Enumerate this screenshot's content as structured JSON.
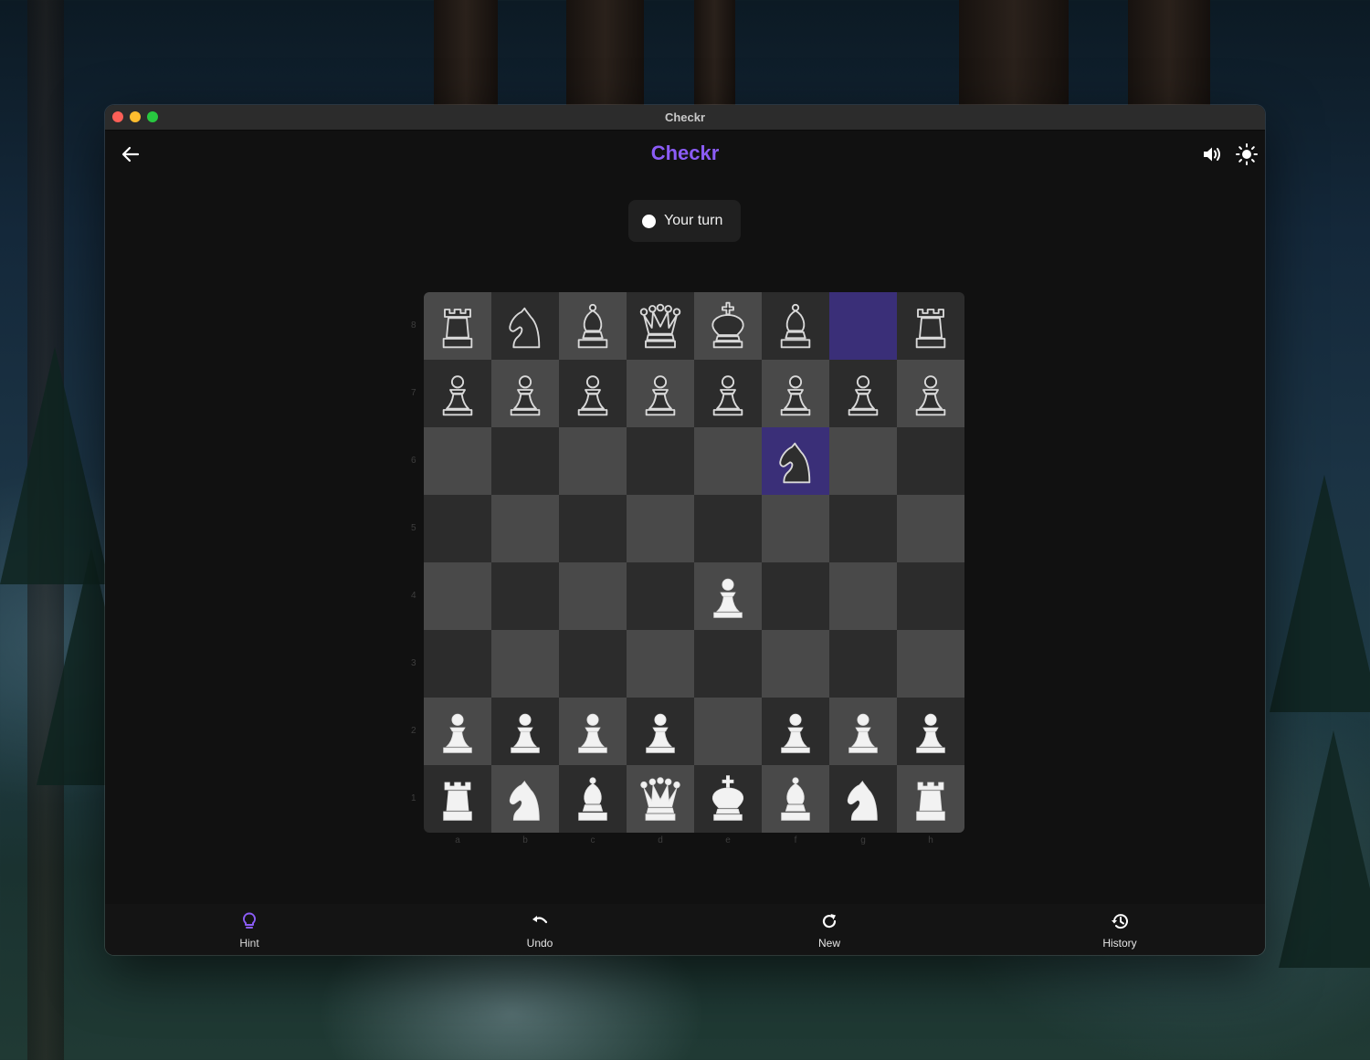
{
  "window": {
    "title": "Checkr"
  },
  "app": {
    "title": "Checkr",
    "accent": "#8b5cf6"
  },
  "header": {
    "back_icon": "arrow-left-icon",
    "sound_icon": "speaker-icon",
    "theme_icon": "sun-icon"
  },
  "status": {
    "turn_text": "Your turn",
    "turn_color": "white"
  },
  "board": {
    "light_square": "#494949",
    "dark_square": "#2c2c2c",
    "highlight": "#3a2f78",
    "highlighted_squares": [
      "g8",
      "f6"
    ],
    "files": [
      "a",
      "b",
      "c",
      "d",
      "e",
      "f",
      "g",
      "h"
    ],
    "ranks": [
      "8",
      "7",
      "6",
      "5",
      "4",
      "3",
      "2",
      "1"
    ],
    "pieces": {
      "a8": "bR",
      "b8": "bN",
      "c8": "bB",
      "d8": "bQ",
      "e8": "bK",
      "f8": "bB",
      "h8": "bR",
      "a7": "bP",
      "b7": "bP",
      "c7": "bP",
      "d7": "bP",
      "e7": "bP",
      "f7": "bP",
      "g7": "bP",
      "h7": "bP",
      "f6": "bN",
      "e4": "wP",
      "a2": "wP",
      "b2": "wP",
      "c2": "wP",
      "d2": "wP",
      "f2": "wP",
      "g2": "wP",
      "h2": "wP",
      "a1": "wR",
      "b1": "wN",
      "c1": "wB",
      "d1": "wQ",
      "e1": "wK",
      "f1": "wB",
      "g1": "wN",
      "h1": "wR"
    }
  },
  "nav": {
    "items": [
      {
        "label": "Hint",
        "icon": "lightbulb-icon",
        "active_color": "#8b5cf6"
      },
      {
        "label": "Undo",
        "icon": "undo-icon"
      },
      {
        "label": "New",
        "icon": "refresh-icon"
      },
      {
        "label": "History",
        "icon": "history-icon"
      }
    ]
  }
}
